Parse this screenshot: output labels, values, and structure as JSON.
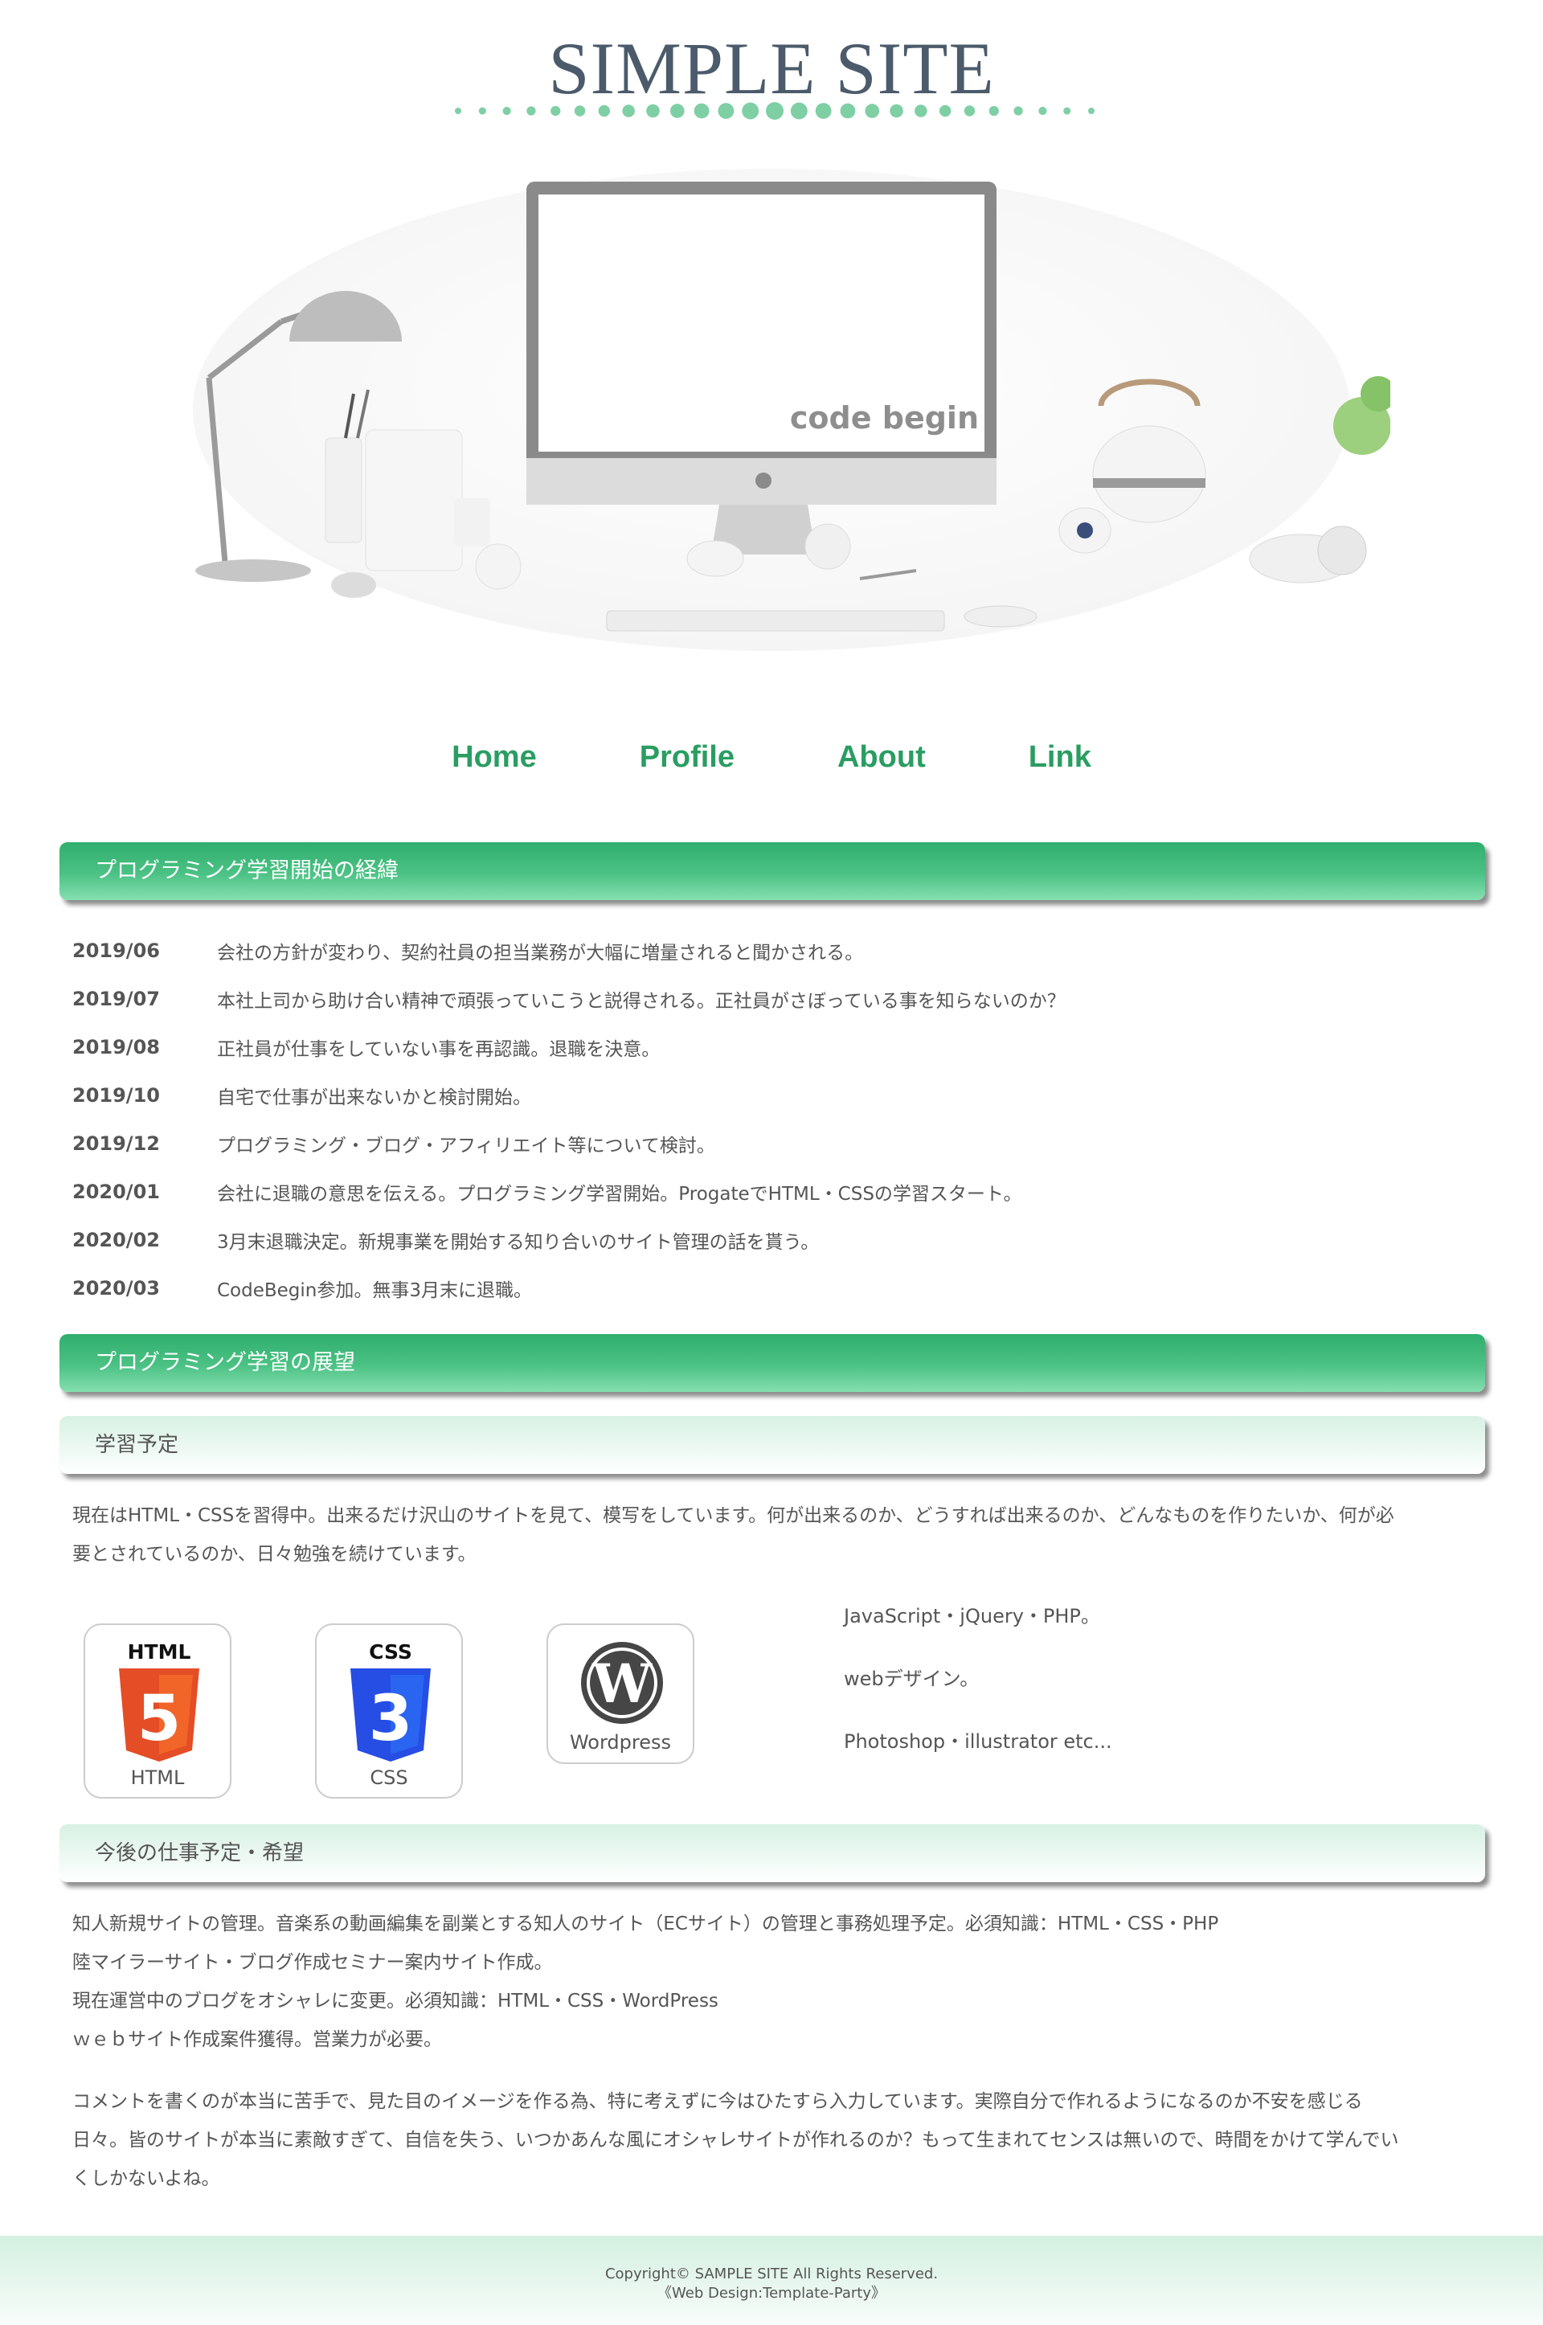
{
  "header": {
    "title": "SIMPLE SITE"
  },
  "hero": {
    "screen_text": "code begin"
  },
  "nav": {
    "items": [
      "Home",
      "Profile",
      "About",
      "Link"
    ]
  },
  "sections": {
    "history_title": "プログラミング学習開始の経緯",
    "outlook_title": "プログラミング学習の展望",
    "study_plan_title": "学習予定",
    "work_plan_title": "今後の仕事予定・希望"
  },
  "history": [
    {
      "date": "2019/06",
      "text": "会社の方針が変わり、契約社員の担当業務が大幅に増量されると聞かされる。"
    },
    {
      "date": "2019/07",
      "text": "本社上司から助け合い精神で頑張っていこうと説得される。正社員がさぼっている事を知らないのか？"
    },
    {
      "date": "2019/08",
      "text": "正社員が仕事をしていない事を再認識。退職を決意。"
    },
    {
      "date": "2019/10",
      "text": "自宅で仕事が出来ないかと検討開始。"
    },
    {
      "date": "2019/12",
      "text": "プログラミング・ブログ・アフィリエイト等について検討。"
    },
    {
      "date": "2020/01",
      "text": "会社に退職の意思を伝える。プログラミング学習開始。ProgateでHTML・CSSの学習スタート。"
    },
    {
      "date": "2020/02",
      "text": "3月末退職決定。新規事業を開始する知り合いのサイト管理の話を貰う。"
    },
    {
      "date": "2020/03",
      "text": "CodeBegin参加。無事3月末に退職。"
    }
  ],
  "study": {
    "text_line1": "現在はHTML・CSSを習得中。出来るだけ沢山のサイトを見て、模写をしています。何が出来るのか、どうすれば出来るのか、どんなものを作りたいか、何が必",
    "text_line2": "要とされているのか、日々勉強を続けています。",
    "icons": [
      {
        "label": "HTML",
        "badge": "HTML",
        "number": "5",
        "color": "#e44d26"
      },
      {
        "label": "CSS",
        "badge": "CSS",
        "number": "3",
        "color": "#264de4"
      },
      {
        "label": "Wordpress",
        "badge": "W",
        "color": "#464646"
      }
    ],
    "list": [
      "JavaScript・jQuery・PHP。",
      "webデザイン。",
      "Photoshop・illustrator etc..."
    ]
  },
  "work": {
    "lines": [
      "知人新規サイトの管理。音楽系の動画編集を副業とする知人のサイト（ECサイト）の管理と事務処理予定。必須知識：HTML・CSS・PHP",
      "陸マイラーサイト・ブログ作成セミナー案内サイト作成。",
      "現在運営中のブログをオシャレに変更。必須知識：HTML・CSS・WordPress",
      "ｗｅｂサイト作成案件獲得。営業力が必要。"
    ],
    "comment_lines": [
      "コメントを書くのが本当に苦手で、見た目のイメージを作る為、特に考えずに今はひたすら入力しています。実際自分で作れるようになるのか不安を感じる",
      "日々。皆のサイトが本当に素敵すぎて、自信を失う、いつかあんな風にオシャレサイトが作れるのか？もって生まれてセンスは無いので、時間をかけて学んでい",
      "くしかないよね。"
    ]
  },
  "footer": {
    "copyright": "Copyright© SAMPLE SITE All Rights Reserved.",
    "credit": "《Web Design:Template-Party》"
  },
  "colors": {
    "accent": "#2a9d62",
    "title": "#4b5b6b",
    "dot": "#7fcfa5"
  }
}
